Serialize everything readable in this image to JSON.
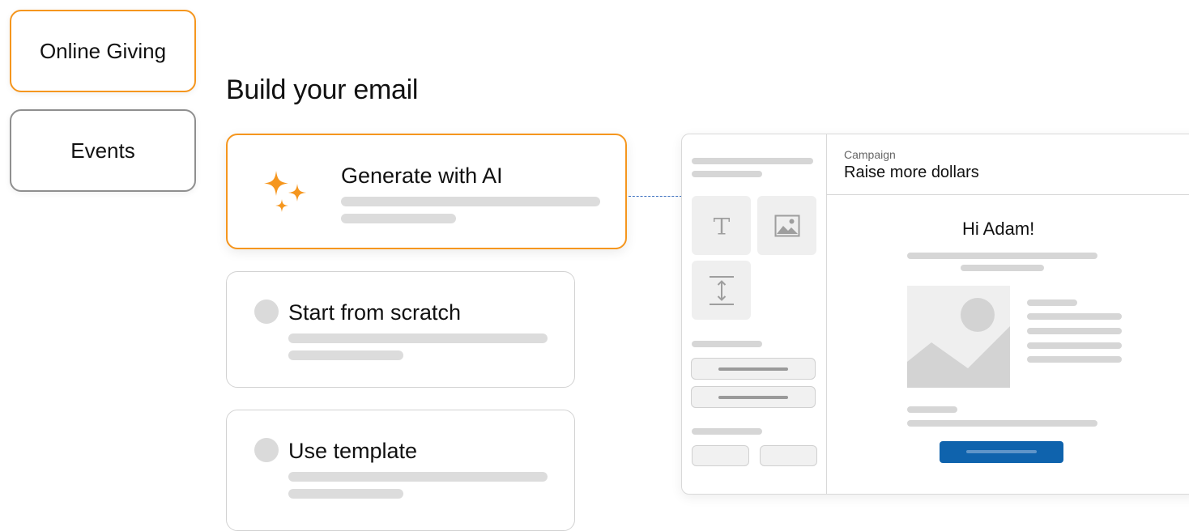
{
  "sidebar": {
    "tabs": [
      {
        "label": "Online Giving",
        "active": true
      },
      {
        "label": "Events",
        "active": false
      }
    ]
  },
  "page": {
    "title": "Build your email"
  },
  "options": [
    {
      "label": "Generate with AI",
      "icon": "sparkles-icon",
      "selected": true
    },
    {
      "label": "Start from scratch",
      "icon": "radio-dot",
      "selected": false
    },
    {
      "label": "Use template",
      "icon": "radio-dot",
      "selected": false
    }
  ],
  "editor": {
    "campaign_label": "Campaign",
    "campaign_name": "Raise more dollars",
    "greeting": "Hi Adam!",
    "blocks": [
      "text-block-icon",
      "image-block-icon",
      "spacer-block-icon"
    ]
  },
  "colors": {
    "accent": "#F5961E",
    "cta": "#0F63AD",
    "connector": "#3A6FBF",
    "placeholder": "#DCDCDC"
  }
}
